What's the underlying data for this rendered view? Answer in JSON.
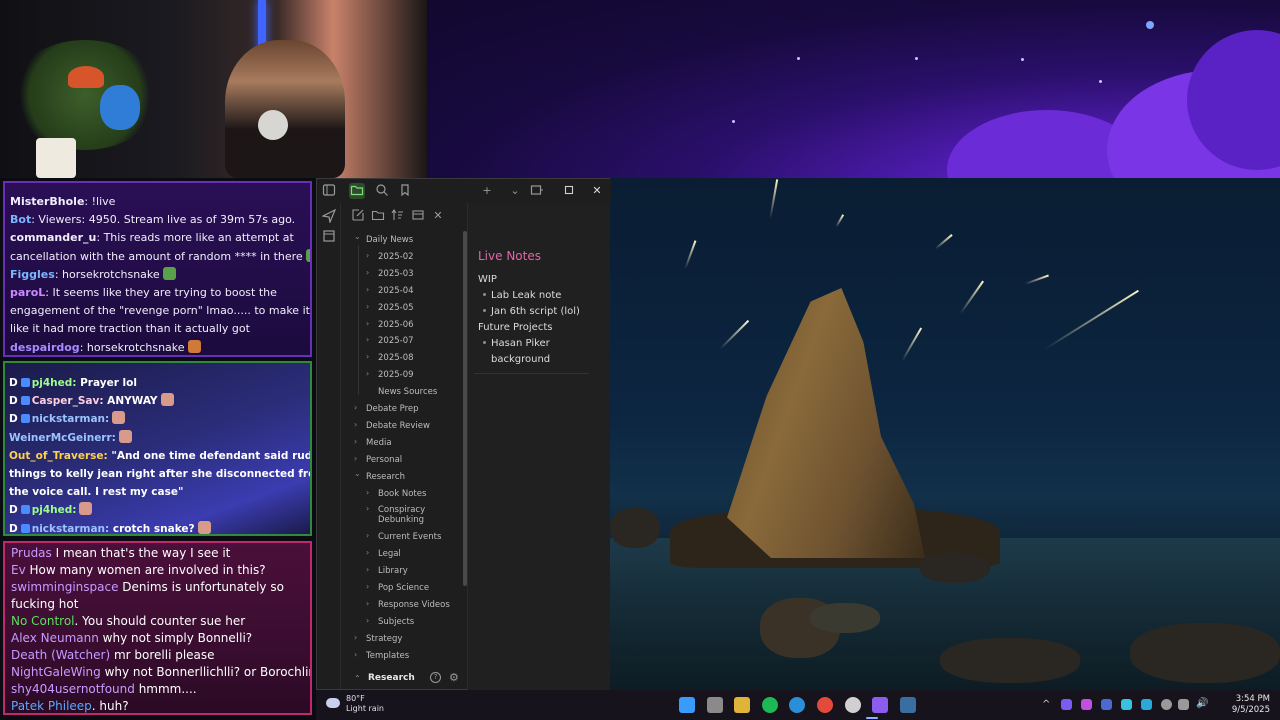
{
  "chat_top": [
    {
      "user": "MisterBhole",
      "user_color": "#f0eefa",
      "text": " !live"
    },
    {
      "user": "Bot",
      "user_color": "#7ab7ff",
      "text": " Viewers: 4950. Stream live as of 39m 57s ago."
    },
    {
      "user": "commander_u",
      "user_color": "#f0eefa",
      "text": " This reads more like an attempt at"
    },
    {
      "user": "",
      "user_color": "#f0eefa",
      "text": "cancellation with the amount of random **** in there"
    },
    {
      "user": "Figgles",
      "user_color": "#7ab7ff",
      "text": " horsekrotchsnake"
    },
    {
      "user": "paroL",
      "user_color": "#c98bff",
      "text": " It seems like they are trying to boost the"
    },
    {
      "user": "",
      "user_color": "#f0eefa",
      "text": "engagement of the \"revenge porn\" lmao..... to make it look"
    },
    {
      "user": "",
      "user_color": "#f0eefa",
      "text": "like it had more traction than it actually got"
    },
    {
      "user": "despairdog",
      "user_color": "#a98bff",
      "text": " horsekrotchsnake"
    }
  ],
  "chat_mid": [
    {
      "badge": "D",
      "user": "pj4hed:",
      "user_color": "#9dff8a",
      "text": "  Prayer lol"
    },
    {
      "badge": "D",
      "user": "Casper_Sav:",
      "user_color": "#ffd0e0",
      "text": "  ANYWAY"
    },
    {
      "badge": "D",
      "user": "nickstarman:",
      "user_color": "#9dc4ff",
      "text": ""
    },
    {
      "badge": "",
      "user": "WeinerMcGeinerr:",
      "user_color": "#9dc4ff",
      "text": ""
    },
    {
      "badge": "",
      "user": "Out_of_Traverse:",
      "user_color": "#ffd24a",
      "text": "  \"And one time defendant said rude"
    },
    {
      "badge": "",
      "user": "",
      "user_color": "#ffffff",
      "text": "things to kelly jean right after she disconnected from"
    },
    {
      "badge": "",
      "user": "",
      "user_color": "#ffffff",
      "text": "the voice call. I rest my case\""
    },
    {
      "badge": "D",
      "user": "pj4hed:",
      "user_color": "#9dff8a",
      "text": ""
    },
    {
      "badge": "D",
      "user": "nickstarman:",
      "user_color": "#9dc4ff",
      "text": "  crotch snake?"
    }
  ],
  "chat_bottom": [
    {
      "user": "Prudas",
      "user_color": "#c79bff",
      "text": " I mean that's the way I see it"
    },
    {
      "user": "Ev",
      "user_color": "#c79bff",
      "text": " How many women are involved in this?"
    },
    {
      "user": "swimminginspace",
      "user_color": "#c79bff",
      "text": " Denims is unfortunately so"
    },
    {
      "user": "",
      "user_color": "#ffffff",
      "text": "fucking hot"
    },
    {
      "user": "No Control",
      "user_color": "#5dde5d",
      "text": ". You should counter sue her"
    },
    {
      "user": "Alex Neumann",
      "user_color": "#c79bff",
      "text": " why not simply Bonnelli?"
    },
    {
      "user": "Death (Watcher)",
      "user_color": "#c79bff",
      "text": " mr borelli please"
    },
    {
      "user": "NightGaleWing",
      "user_color": "#c79bff",
      "text": " why not Bonnerllichlli? or Borochlini?"
    },
    {
      "user": "shy404usernotfound",
      "user_color": "#c79bff",
      "text": " hmmm...."
    },
    {
      "user": "Patek Phileep",
      "user_color": "#5aa8ff",
      "text": ". huh?"
    }
  ],
  "obsidian": {
    "tree": [
      {
        "label": "Daily News",
        "level": 0,
        "open": true
      },
      {
        "label": "2025-02",
        "level": 1,
        "open": false
      },
      {
        "label": "2025-03",
        "level": 1,
        "open": false
      },
      {
        "label": "2025-04",
        "level": 1,
        "open": false
      },
      {
        "label": "2025-05",
        "level": 1,
        "open": false
      },
      {
        "label": "2025-06",
        "level": 1,
        "open": false
      },
      {
        "label": "2025-07",
        "level": 1,
        "open": false
      },
      {
        "label": "2025-08",
        "level": 1,
        "open": false
      },
      {
        "label": "2025-09",
        "level": 1,
        "open": false
      },
      {
        "label": "News Sources",
        "level": 1,
        "open": null
      },
      {
        "label": "Debate Prep",
        "level": 0,
        "open": false
      },
      {
        "label": "Debate Review",
        "level": 0,
        "open": false
      },
      {
        "label": "Media",
        "level": 0,
        "open": false
      },
      {
        "label": "Personal",
        "level": 0,
        "open": false
      },
      {
        "label": "Research",
        "level": 0,
        "open": true
      },
      {
        "label": "Book Notes",
        "level": 1,
        "open": false
      },
      {
        "label": "Conspiracy",
        "label2": "Debunking",
        "level": 1,
        "open": false
      },
      {
        "label": "Current Events",
        "level": 1,
        "open": false
      },
      {
        "label": "Legal",
        "level": 1,
        "open": false
      },
      {
        "label": "Library",
        "level": 1,
        "open": false
      },
      {
        "label": "Pop Science",
        "level": 1,
        "open": false
      },
      {
        "label": "Response Videos",
        "level": 1,
        "open": false
      },
      {
        "label": "Subjects",
        "level": 1,
        "open": false
      },
      {
        "label": "Strategy",
        "level": 0,
        "open": false
      },
      {
        "label": "Templates",
        "level": 0,
        "open": false
      }
    ],
    "vault_name": "Research",
    "note": {
      "title": "Live Notes",
      "lines": [
        {
          "text": "WIP",
          "indent": false
        },
        {
          "text": "Lab Leak note",
          "indent": true
        },
        {
          "text": "Jan 6th script (lol)",
          "indent": true
        },
        {
          "text": "Future Projects",
          "indent": false
        },
        {
          "text": "Hasan Piker",
          "indent": true
        },
        {
          "text": "background",
          "indent": "cont"
        }
      ]
    }
  },
  "taskbar": {
    "weather_temp": "80°F",
    "weather_desc": "Light rain",
    "time": "3:54 PM",
    "date": "9/5/2025"
  }
}
